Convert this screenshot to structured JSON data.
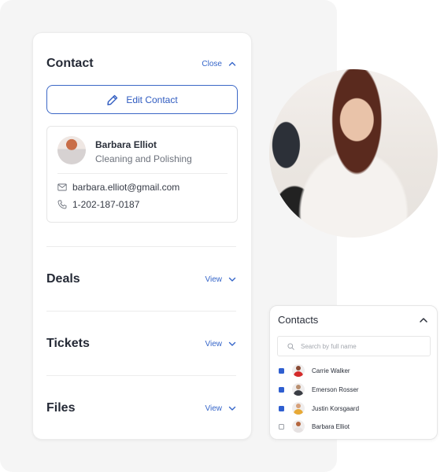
{
  "contact_panel": {
    "title": "Contact",
    "close_label": "Close",
    "edit_button_label": "Edit Contact",
    "contact": {
      "name": "Barbara Elliot",
      "role": "Cleaning and Polishing",
      "email": "barbara.elliot@gmail.com",
      "phone": "1-202-187-0187"
    },
    "sections": [
      {
        "title": "Deals",
        "action_label": "View"
      },
      {
        "title": "Tickets",
        "action_label": "View"
      },
      {
        "title": "Files",
        "action_label": "View"
      }
    ]
  },
  "photo": {
    "description": "Woman in white blouse smiling"
  },
  "contacts_list": {
    "title": "Contacts",
    "search_placeholder": "Search by full name",
    "items": [
      {
        "name": "Carrie Walker",
        "checked": true,
        "avatar_color": "#d42b2b"
      },
      {
        "name": "Emerson Rosser",
        "checked": true,
        "avatar_color": "#3a3d44"
      },
      {
        "name": "Justin Korsgaard",
        "checked": true,
        "avatar_color": "#e7a936"
      },
      {
        "name": "Barbara Elliot",
        "checked": false,
        "avatar_color": "#e6e2e2"
      }
    ]
  },
  "colors": {
    "accent": "#3565c9",
    "panel_bg": "#f5f5f5",
    "checkbox_on": "#2f5fd0"
  }
}
